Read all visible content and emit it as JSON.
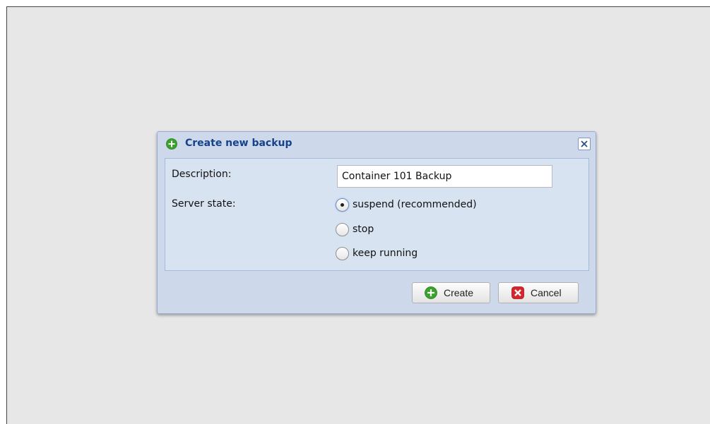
{
  "dialog": {
    "title": "Create new backup",
    "title_icon": "add-circle-icon",
    "close_icon": "close-icon"
  },
  "form": {
    "description": {
      "label": "Description:",
      "value": "Container 101 Backup"
    },
    "server_state": {
      "label": "Server state:",
      "selected": "suspend (recommended)",
      "options": [
        {
          "label": "suspend (recommended)",
          "checked": true
        },
        {
          "label": "stop",
          "checked": false
        },
        {
          "label": "keep running",
          "checked": false
        }
      ]
    }
  },
  "buttons": {
    "create_label": "Create",
    "create_icon": "add-circle-icon",
    "cancel_label": "Cancel",
    "cancel_icon": "cancel-icon"
  },
  "colors": {
    "page_background": "#e7e7e7",
    "dialog_background": "#cdd9ea",
    "title_text": "#15428b",
    "create_icon": "#3aa32b",
    "cancel_icon": "#d6262c"
  }
}
